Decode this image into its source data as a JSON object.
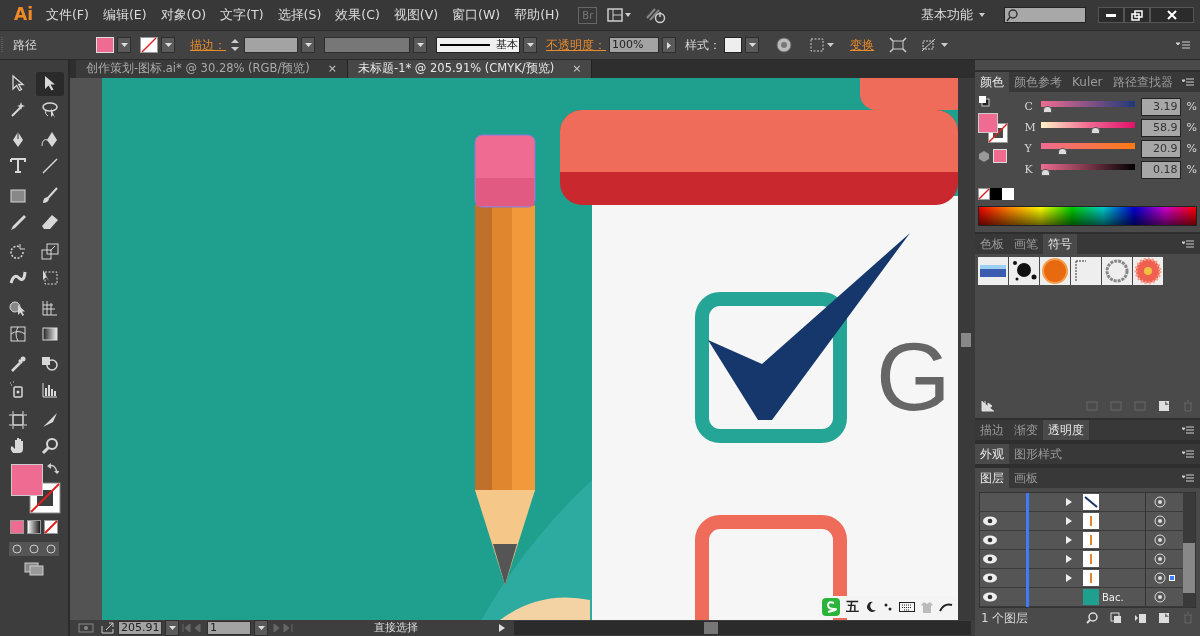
{
  "menu_bar": {
    "logo": "Ai",
    "menus": [
      "文件(F)",
      "编辑(E)",
      "对象(O)",
      "文字(T)",
      "选择(S)",
      "效果(C)",
      "视图(V)",
      "窗口(W)",
      "帮助(H)"
    ],
    "bridge": "Br",
    "workspace": "基本功能"
  },
  "control_bar": {
    "selection_type": "路径",
    "stroke_label": "描边：",
    "stroke_style": "基本",
    "opacity_label": "不透明度：",
    "opacity": "100%",
    "style_label": "样式：",
    "transform_link": "变换"
  },
  "document_tabs": [
    {
      "title": "创作策划-图标.ai* @ 30.28% (RGB/预览)",
      "close": "×",
      "selected": false
    },
    {
      "title": "未标题-1* @ 205.91% (CMYK/预览)",
      "close": "×",
      "selected": true
    }
  ],
  "tools": [
    {
      "selected": false
    },
    {
      "selected": true
    },
    {
      "selected": false
    },
    {
      "selected": false
    },
    {
      "selected": false
    },
    {
      "selected": false
    },
    {
      "selected": false
    },
    {
      "selected": false
    },
    {
      "selected": false
    },
    {
      "selected": false
    },
    {
      "selected": false
    },
    {
      "selected": false
    },
    {
      "selected": false
    },
    {
      "selected": false
    },
    {
      "selected": false
    },
    {
      "selected": false
    },
    {
      "selected": false
    },
    {
      "selected": false
    },
    {
      "selected": false
    },
    {
      "selected": false
    },
    {
      "selected": false
    },
    {
      "selected": false
    },
    {
      "selected": false
    },
    {
      "selected": false
    },
    {
      "selected": false
    },
    {
      "selected": false
    },
    {
      "selected": false
    },
    {
      "selected": false
    }
  ],
  "artwork": {
    "letter": "G"
  },
  "color_panel": {
    "tabs": [
      {
        "label": "颜色",
        "selected": true
      },
      {
        "label": "颜色参考",
        "selected": false
      },
      {
        "label": "Kuler",
        "selected": false
      },
      {
        "label": "路径查找器",
        "selected": false
      }
    ],
    "channels": [
      {
        "name": "C",
        "level": 0.03,
        "reading": "3.19",
        "unit": "%"
      },
      {
        "name": "M",
        "level": 0.59,
        "reading": "58.9",
        "unit": "%"
      },
      {
        "name": "Y",
        "level": 0.21,
        "reading": "20.9",
        "unit": "%"
      },
      {
        "name": "K",
        "level": 0.0,
        "reading": "0.18",
        "unit": "%"
      }
    ]
  },
  "symbols_panel": {
    "tabs": [
      {
        "label": "色板",
        "selected": false
      },
      {
        "label": "画笔",
        "selected": false
      },
      {
        "label": "符号",
        "selected": true
      }
    ]
  },
  "stroke_panel": {
    "tabs": [
      {
        "label": "描边",
        "selected": false
      },
      {
        "label": "渐变",
        "selected": false
      },
      {
        "label": "透明度",
        "selected": true
      }
    ]
  },
  "appearance_panel": {
    "tabs": [
      {
        "label": "外观",
        "selected": true
      },
      {
        "label": "图形样式",
        "selected": false
      }
    ]
  },
  "layers_panel": {
    "tabs": [
      {
        "label": "图层",
        "selected": true
      },
      {
        "label": "画板",
        "selected": false
      }
    ],
    "rows": [
      {
        "visible": false,
        "expandable": true,
        "targeted": false
      },
      {
        "visible": true,
        "expandable": true,
        "targeted": false
      },
      {
        "visible": true,
        "expandable": true,
        "targeted": false
      },
      {
        "visible": true,
        "expandable": true,
        "targeted": false
      },
      {
        "visible": true,
        "expandable": true,
        "targeted": true
      },
      {
        "visible": true,
        "expandable": false,
        "targeted": false,
        "label": "Bac."
      }
    ],
    "count": "1 个图层"
  },
  "status_bar": {
    "zoom": "205.91",
    "artboard": "1",
    "tool": "直接选择"
  },
  "ime_bar": {
    "mode": "五"
  }
}
